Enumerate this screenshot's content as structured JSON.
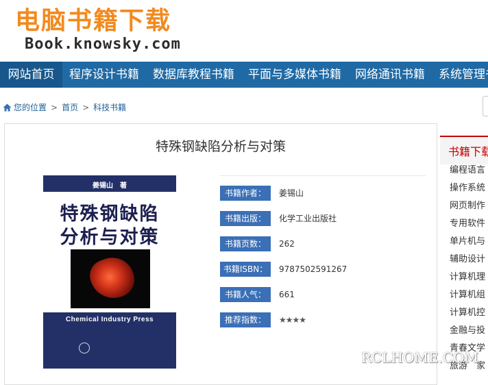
{
  "logo": {
    "cn": "电脑书籍下载",
    "en": "Book.knowsky.com"
  },
  "nav": [
    {
      "label": "网站首页",
      "active": true
    },
    {
      "label": "程序设计书籍"
    },
    {
      "label": "数据库教程书籍"
    },
    {
      "label": "平面与多媒体书籍"
    },
    {
      "label": "网络通讯书籍"
    },
    {
      "label": "系统管理书"
    }
  ],
  "breadcrumb": {
    "prefix": "您的位置",
    "items": [
      "首页",
      "科技书籍"
    ],
    "sep": ">"
  },
  "book": {
    "title": "特殊钢缺陷分析与对策",
    "cover": {
      "author": "姜锡山　著",
      "line1": "特殊钢缺陷",
      "line2": "分析与对策",
      "press_en": "Chemical  Industry  Press"
    },
    "info": [
      {
        "label": "书籍作者：",
        "value": "姜锡山"
      },
      {
        "label": "书籍出版：",
        "value": "化学工业出版社"
      },
      {
        "label": "书籍页数：",
        "value": "262"
      },
      {
        "label": "书籍ISBN：",
        "value": "9787502591267"
      },
      {
        "label": "书籍人气：",
        "value": "661"
      },
      {
        "label": "推荐指数：",
        "value": "★★★★"
      }
    ]
  },
  "sidebar": {
    "title": "书籍下载",
    "items": [
      "编程语言",
      "操作系统",
      "网页制作",
      "专用软件",
      "单片机与",
      "辅助设计",
      "计算机理",
      "计算机组",
      "计算机控",
      "金融与投",
      "青春文学",
      "旅游　家"
    ]
  },
  "watermark": "RCLHOME.COM",
  "colors": {
    "nav_bg": "#1f6aa5",
    "label_bg": "#3b6fb6",
    "logo": "#f28a1e",
    "sidebar_accent": "#c40000"
  }
}
